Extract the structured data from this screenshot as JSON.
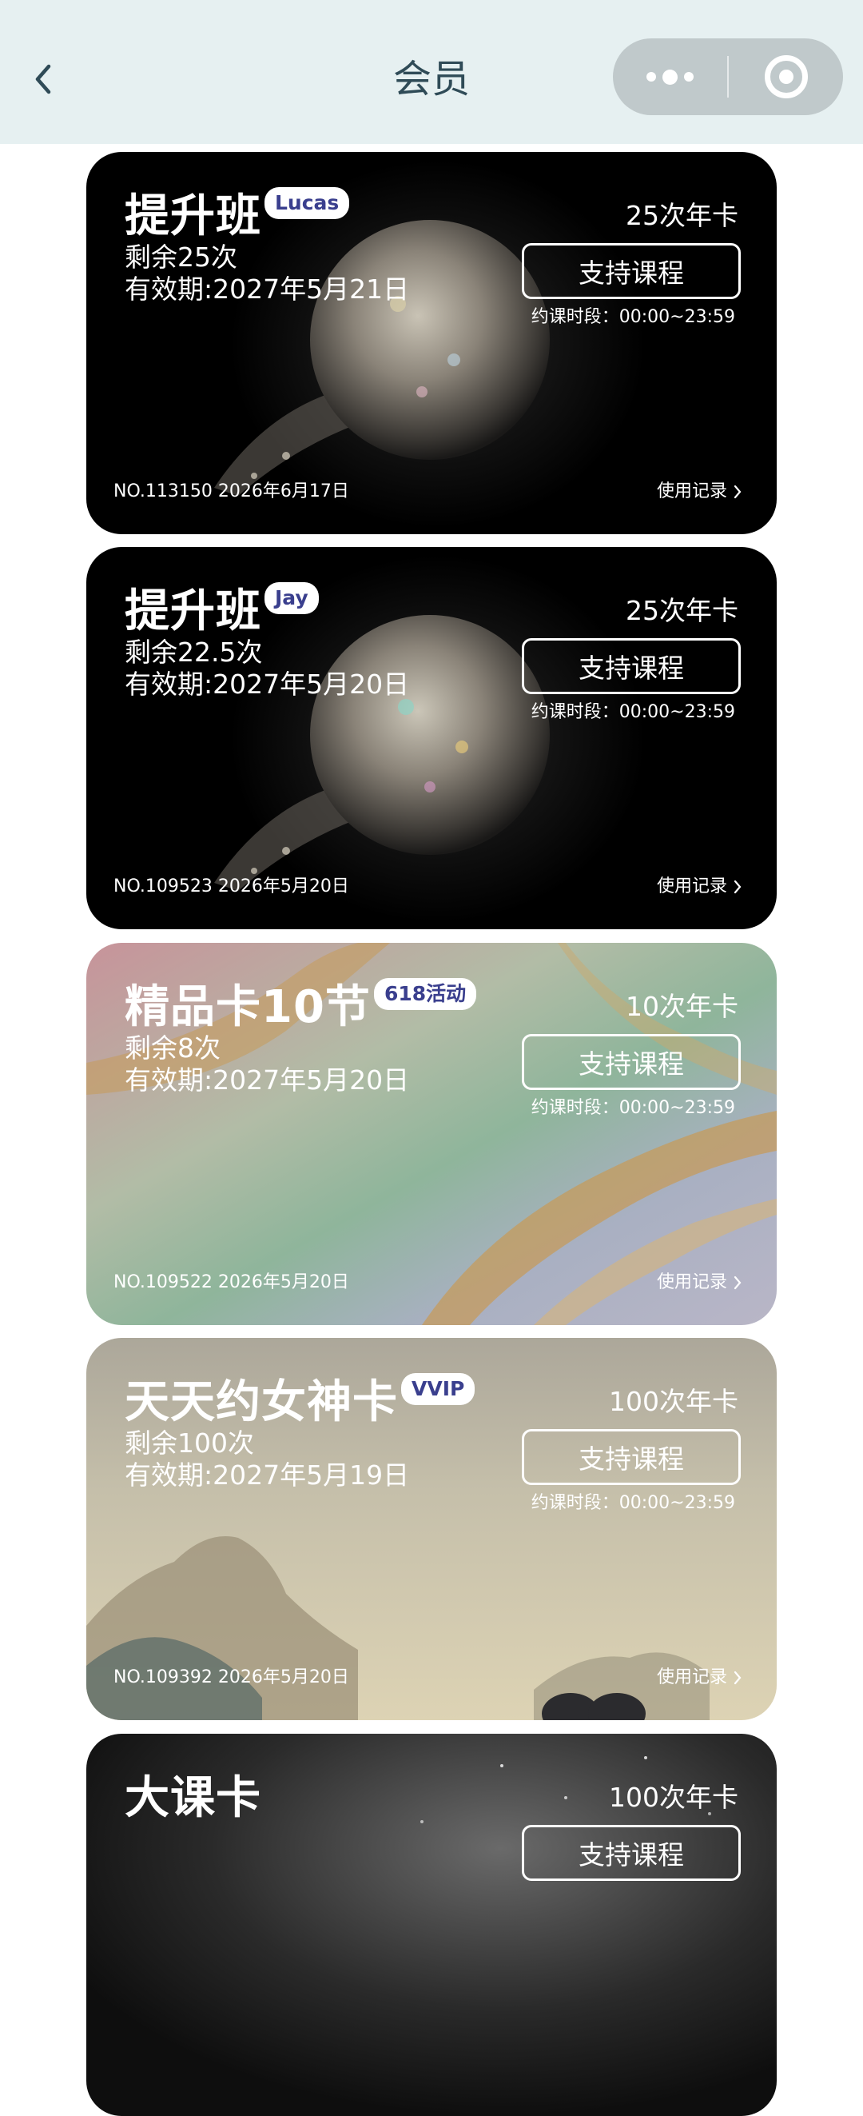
{
  "nav": {
    "title": "会员"
  },
  "cards": [
    {
      "name": "提升班",
      "tag": "Lucas",
      "remaining": "剩余25次",
      "validity": "有效期:2027年5月21日",
      "type": "25次年卡",
      "support_label": "支持课程",
      "hours": "约课时段：00:00~23:59",
      "number": "NO.113150 2026年6月17日",
      "usage_label": "使用记录"
    },
    {
      "name": "提升班",
      "tag": "Jay",
      "remaining": "剩余22.5次",
      "validity": "有效期:2027年5月20日",
      "type": "25次年卡",
      "support_label": "支持课程",
      "hours": "约课时段：00:00~23:59",
      "number": "NO.109523 2026年5月20日",
      "usage_label": "使用记录"
    },
    {
      "name": "精品卡10节",
      "tag": "618活动",
      "remaining": "剩余8次",
      "validity": "有效期:2027年5月20日",
      "type": "10次年卡",
      "support_label": "支持课程",
      "hours": "约课时段：00:00~23:59",
      "number": "NO.109522 2026年5月20日",
      "usage_label": "使用记录"
    },
    {
      "name": "天天约女神卡",
      "tag": "VVIP",
      "remaining": "剩余100次",
      "validity": "有效期:2027年5月19日",
      "type": "100次年卡",
      "support_label": "支持课程",
      "hours": "约课时段：00:00~23:59",
      "number": "NO.109392 2026年5月20日",
      "usage_label": "使用记录"
    },
    {
      "name": "大课卡",
      "type": "100次年卡",
      "support_label": "支持课程"
    }
  ]
}
